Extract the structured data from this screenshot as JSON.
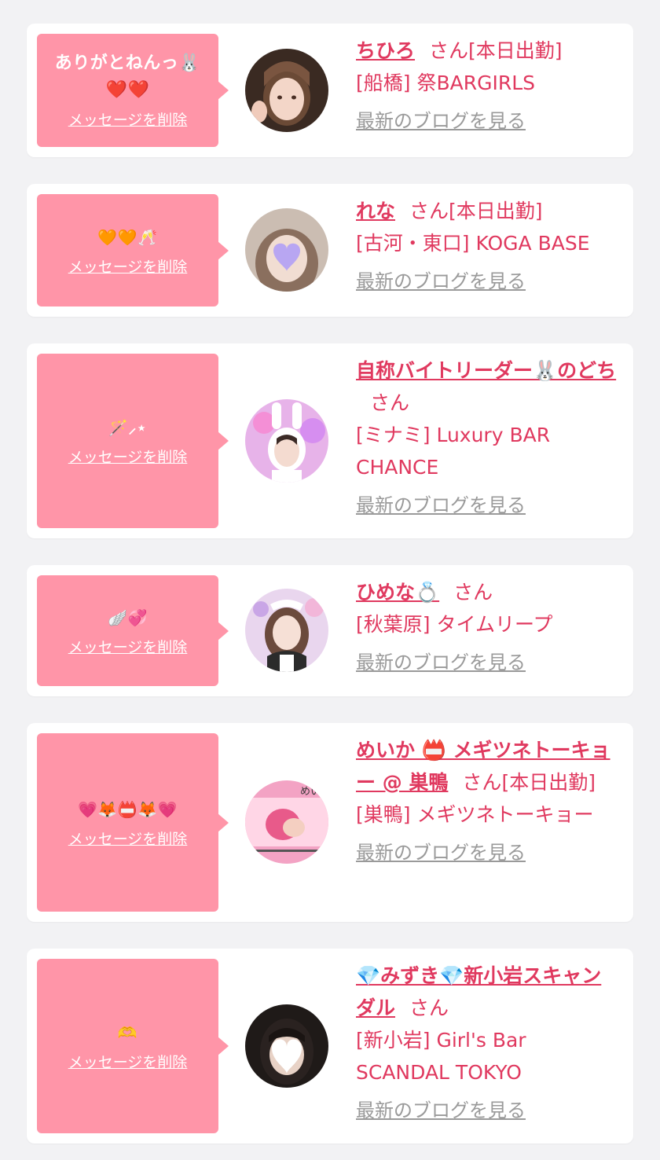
{
  "common": {
    "delete_label": "メッセージを削除",
    "blog_label": "最新のブログを見る",
    "san": "さん"
  },
  "items": [
    {
      "message": "ありがとねんっ🐰❤️❤️",
      "name": "ちひろ",
      "suffix": "[本日出勤]",
      "shop": "[船橋] 祭BARGIRLS"
    },
    {
      "message": "🧡🧡🥂",
      "name": "れな",
      "suffix": "[本日出勤]",
      "shop": "[古河・東口] KOGA BASE"
    },
    {
      "message": "🪄⸝⋆",
      "name": "自称バイトリーダー🐰のどち",
      "suffix": "",
      "shop": "[ミナミ] Luxury BAR CHANCE"
    },
    {
      "message": "🪽💞",
      "name": "ひめな💍",
      "suffix": "",
      "shop": "[秋葉原] タイムリープ"
    },
    {
      "message": "💗🦊📛🦊💗",
      "name": "めいか 📛 メギツネトーキョー @ 巣鴨",
      "suffix": "[本日出勤]",
      "shop": "[巣鴨] メギツネトーキョー",
      "avatar_text": "めいか"
    },
    {
      "message": "🫶",
      "name": "💎みずき💎新小岩スキャンダル",
      "suffix": "",
      "shop": "[新小岩] Girl's Bar SCANDAL TOKYO"
    }
  ]
}
